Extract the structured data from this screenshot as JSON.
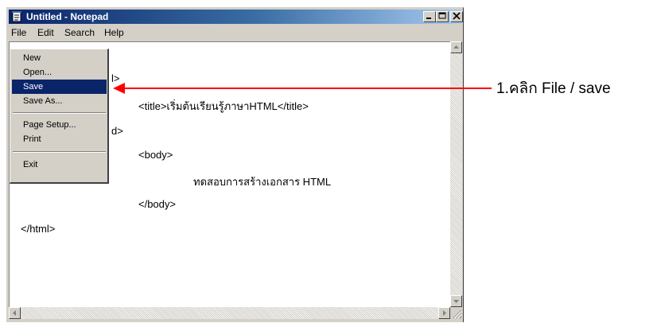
{
  "window": {
    "title": "Untitled - Notepad",
    "controls": [
      "minimize",
      "maximize",
      "close"
    ]
  },
  "menubar": {
    "file": "File",
    "edit": "Edit",
    "search": "Search",
    "help": "Help"
  },
  "file_menu": {
    "items": [
      "New",
      "Open...",
      "Save",
      "Save As...",
      "Page Setup...",
      "Print",
      "Exit"
    ],
    "selected": "Save"
  },
  "editor": {
    "lines": {
      "l1_fragment": "l>",
      "l2": "<title>เริ่มต้นเรียนรู้ภาษาHTML</title>",
      "l3_fragment": "d>",
      "l4": "<body>",
      "l5": "ทดสอบการสร้างเอกสาร HTML",
      "l6": "</body>",
      "l7": "</html>"
    }
  },
  "annotation": {
    "text": "1.คลิก File / save",
    "color": "#ff0000"
  },
  "colors": {
    "titlebar_start": "#0a246a",
    "titlebar_end": "#a6caf0",
    "menu_highlight": "#0a246a",
    "window_face": "#d4d0c8",
    "arrow": "#ff0000"
  }
}
